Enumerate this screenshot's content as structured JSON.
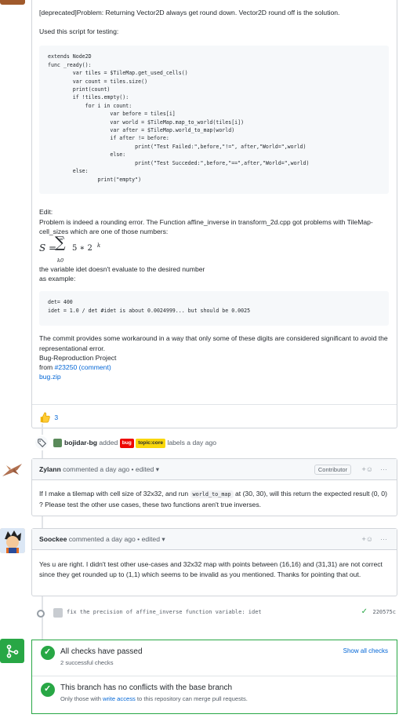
{
  "issue_body": {
    "line1": "[deprecated]Problem: Returning Vector2D always get round down. Vector2D round off is the solution.",
    "line2": "Used this script for testing:",
    "code1": [
      "extends Node2D",
      "func _ready():",
      "        var tiles = $TileMap.get_used_cells()",
      "        var count = tiles.size()",
      "        print(count)",
      "        if !tiles.empty():",
      "            for i in count:",
      "                    var before = tiles[i]",
      "                    var world = $TileMap.map_to_world(tiles[i])",
      "                    var after = $TileMap.world_to_map(world)",
      "                    if after != before:",
      "                            print(\"Test Failed:\",before,\"!=\", after,\"World=\",world)",
      "                    else:",
      "                            print(\"Test Succeded:\",before,\"==\",after,\"World=\",world)",
      "        else:",
      "                print(\"empty\")"
    ],
    "edit_label": "Edit:",
    "edit_text": "Problem is indeed a rounding error. The Function affine_inverse in transform_2d.cpp got problems with TileMap-cell_sizes which are one of those numbers:",
    "formula_S": "S =",
    "formula_top": "∞",
    "formula_sigma": "∑",
    "formula_bottom": "k0",
    "formula_term": "5 ∗ 2",
    "formula_exp": "k",
    "idet_text": "the variable idet doesn't evaluate to the desired number",
    "example_label": "as example:",
    "code2": [
      "det= 400",
      "idet = 1.0 / det #idet is about 0.0024999... but should be 0.0025"
    ],
    "commit_text": "The commit provides some workaround in a way that only some of these digits are considered significant to avoid the representational error.",
    "bug_project": "Bug-Reproduction Project",
    "from_prefix": "from ",
    "from_link": "#23250 (comment)",
    "zip_link": "bug.zip",
    "reaction_count": "3"
  },
  "label_event": {
    "user": "bojidar-bg",
    "action": "added",
    "label1": "bug",
    "label2": "topic:core",
    "suffix": "labels a day ago"
  },
  "comment_zylann": {
    "user": "Zylann",
    "meta": "commented a day ago • edited ▾",
    "badge": "Contributor",
    "text_before": "If I make a tilemap with cell size of 32x32, and run",
    "code": "world_to_map",
    "text_after": "at (30, 30), will this return the expected result (0, 0) ? Please test the other use cases, these two functions aren't true inverses."
  },
  "comment_soockee": {
    "user": "Soockee",
    "meta": "commented a day ago • edited ▾",
    "text": "Yes u are right. I didn't test other use-cases and 32x32 map with points between (16,16) and (31,31) are not correct since they get rounded up to (1,1) which seems to be invalid as you mentioned. Thanks for pointing that out."
  },
  "commit_event": {
    "message": "fix the precision of affine_inverse function variable: idet",
    "sha": "220575c"
  },
  "merge_box": {
    "checks_title": "All checks have passed",
    "checks_sub": "2 successful checks",
    "show_all": "Show all checks",
    "conflicts_title": "This branch has no conflicts with the base branch",
    "conflicts_sub_prefix": "Only those with ",
    "conflicts_sub_link": "write access",
    "conflicts_sub_suffix": " to this repository can merge pull requests."
  },
  "colors": {
    "accent": "#0366d6",
    "success": "#28a745",
    "bug_label": "#ee0701",
    "topic_label": "#f9d70a"
  }
}
